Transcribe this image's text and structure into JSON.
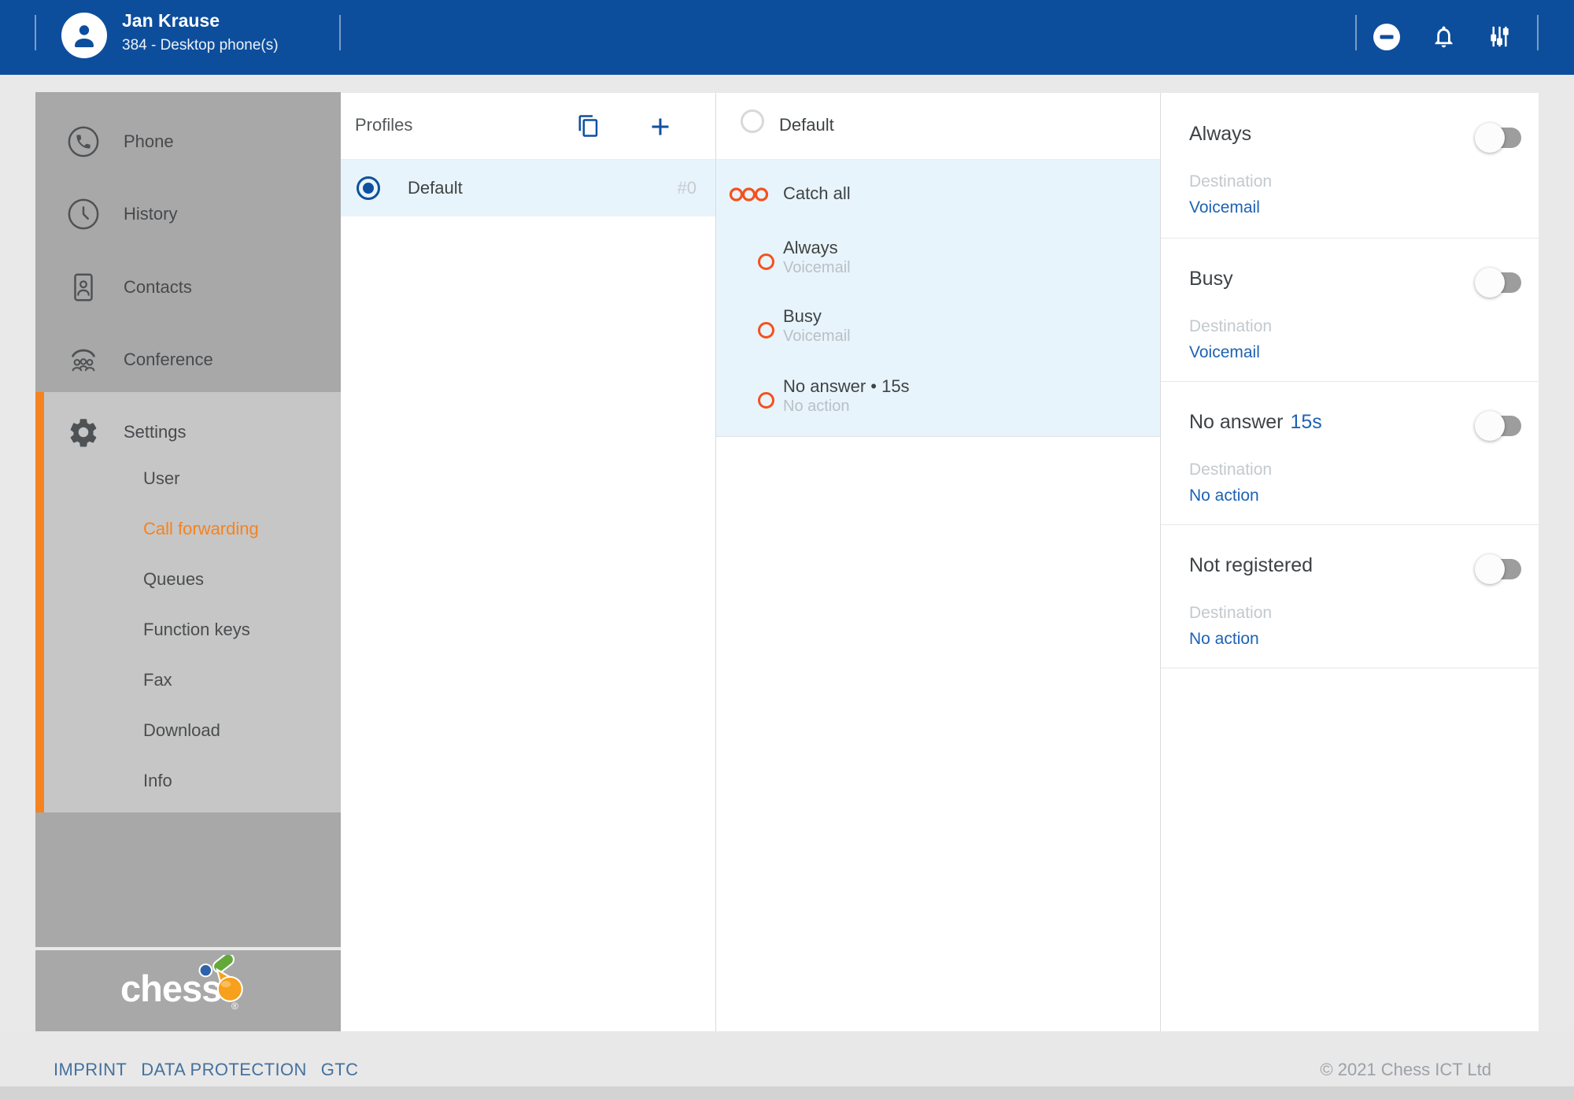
{
  "topbar": {
    "user_name": "Jan Krause",
    "user_line": "384 - Desktop phone(s)",
    "icons": [
      "do-not-disturb",
      "notifications-bell",
      "tune-sliders"
    ]
  },
  "sidebar": {
    "main_items": [
      {
        "icon": "phone-icon",
        "label": "Phone"
      },
      {
        "icon": "history-icon",
        "label": "History"
      },
      {
        "icon": "contacts-icon",
        "label": "Contacts"
      },
      {
        "icon": "conference-icon",
        "label": "Conference"
      }
    ],
    "settings": {
      "label": "Settings",
      "items": [
        {
          "label": "User",
          "active": false
        },
        {
          "label": "Call forwarding",
          "active": true
        },
        {
          "label": "Queues",
          "active": false
        },
        {
          "label": "Function keys",
          "active": false
        },
        {
          "label": "Fax",
          "active": false
        },
        {
          "label": "Download",
          "active": false
        },
        {
          "label": "Info",
          "active": false
        }
      ]
    },
    "logo": {
      "text": "chess",
      "reg": "®"
    }
  },
  "profiles": {
    "title": "Profiles",
    "rows": [
      {
        "label": "Default",
        "id": "#0",
        "selected": true
      }
    ]
  },
  "detail": {
    "header": "Default",
    "catch_all": "Catch all",
    "rules": [
      {
        "title": "Always",
        "destination": "Voicemail"
      },
      {
        "title": "Busy",
        "destination": "Voicemail"
      },
      {
        "title": "No answer • 15s",
        "destination": "No action"
      }
    ]
  },
  "forwarding": {
    "destination_label": "Destination",
    "sections": [
      {
        "title": "Always",
        "suffix": "",
        "value": "Voicemail",
        "enabled": false
      },
      {
        "title": "Busy",
        "suffix": "",
        "value": "Voicemail",
        "enabled": false
      },
      {
        "title": "No answer",
        "suffix": "15s",
        "value": "No action",
        "enabled": false
      },
      {
        "title": "Not registered",
        "suffix": "",
        "value": "No action",
        "enabled": false
      }
    ]
  },
  "footer": {
    "links": [
      "IMPRINT",
      "DATA PROTECTION",
      "GTC"
    ],
    "copyright": "© 2021 Chess ICT Ltd"
  },
  "colors": {
    "topbar_blue": "#0d4e9c",
    "accent_orange": "#f5831f",
    "ring_orange": "#f4511e",
    "link_blue": "#1d62b4",
    "selection_blue": "#e8f4fb",
    "sidebar_gray": "#a8a8a8",
    "settings_gray": "#c6c6c6"
  }
}
